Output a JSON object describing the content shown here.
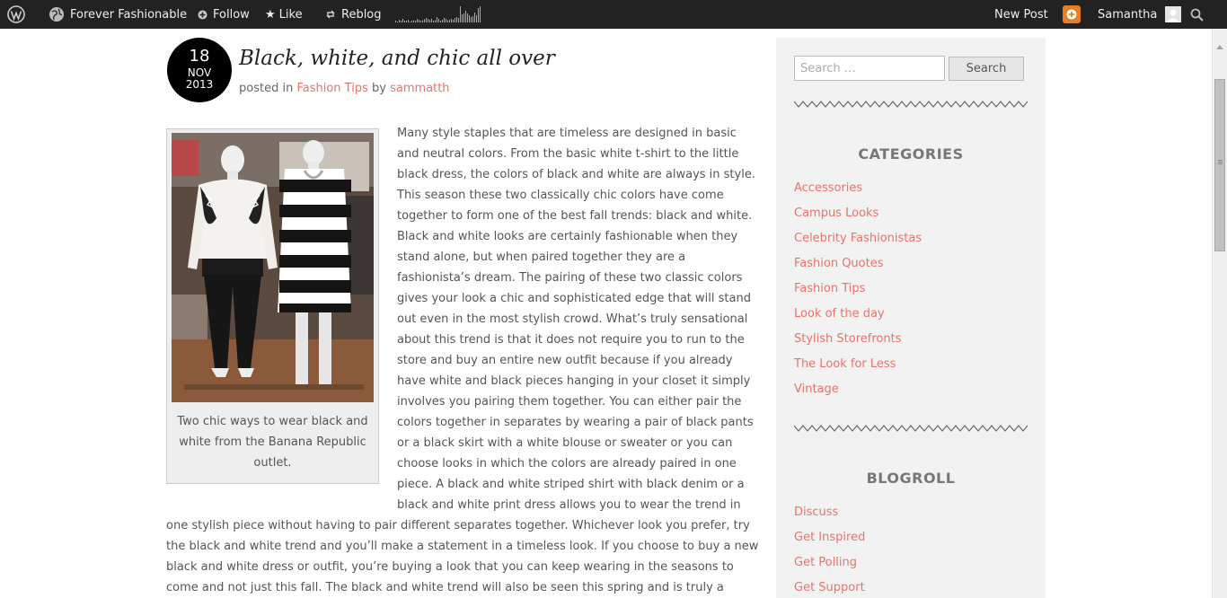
{
  "adminbar": {
    "wordpress_icon": "wordpress-logo-icon",
    "site_name": "Forever Fashionable",
    "follow_label": "Follow",
    "like_label": "Like",
    "reblog_label": "Reblog",
    "new_post_label": "New Post",
    "user_name": "Samantha",
    "stats_bars": [
      0.1,
      0.05,
      0.15,
      0.1,
      0.2,
      0.1,
      0.1,
      0.15,
      0.05,
      0.1,
      0.12,
      0.1,
      0.2,
      0.15,
      0.1,
      0.12,
      0.18,
      0.25,
      0.2,
      0.15,
      0.2,
      0.1,
      0.12,
      0.3,
      0.2,
      0.1,
      0.15,
      0.25,
      0.2,
      0.12,
      0.15,
      0.2,
      0.15,
      0.25,
      0.3,
      0.25,
      0.9,
      0.45,
      0.5,
      0.65,
      0.5,
      0.4,
      0.3,
      0.35,
      0.55,
      0.4,
      0.8,
      0.9
    ],
    "accent_color": "#e87e24"
  },
  "post": {
    "date_day": "18",
    "date_month": "NOV",
    "date_year": "2013",
    "title": "Black, white, and chic all over",
    "meta_prefix": "posted in",
    "category": "Fashion Tips",
    "meta_by": "by",
    "author": "sammatth",
    "link_color": "#e9736b",
    "caption_lines": [
      "Two chic ways to wear black and",
      "white from the Banana Republic",
      "outlet."
    ],
    "body_lines": [
      "Many style staples that are timeless are designed in basic",
      "and neutral colors. From the basic  white t-shirt to the little",
      "black dress, the colors of black and white are always in style.",
      "This  season these two classically chic colors have come",
      "together to form one of the best fall  trends: black and white.",
      "Black and white looks are certainly fashionable when they",
      "stand  alone, but when paired together they are a",
      "fashionista’s dream. The pairing of these two  classic colors",
      "gives your look a chic and sophisticated edge that will stand",
      "out even in the  most stylish crowd. What’s truly sensational",
      "about this trend is that it does not require you to  run to the",
      "store and buy an entire new outfit because if you already",
      "have white and black  pieces hanging in your closet it simply",
      "involves you pairing them together. You can either  pair the",
      "colors together in separates by wearing a pair of black pants",
      "or a black skirt with a  white blouse or sweater or you can",
      "choose looks in which the colors are already paired in one",
      " piece. A black and white striped shirt with black denim or a",
      "black and white print dress allows  you to wear the trend in"
    ],
    "body_full_lines": [
      "one stylish piece without having to pair different separates together.  Whichever look you prefer, try",
      "the black and white trend and you’ll make a statement in a  timeless look. If you choose to buy a new",
      "black and white dress or outfit, you’re buying a  look that you can keep wearing in the seasons to",
      "come and not just this fall. The black and  white trend will also be seen this spring and is truly a"
    ]
  },
  "sidebar": {
    "search_placeholder": "Search …",
    "search_button": "Search",
    "categories_title": "CATEGORIES",
    "categories": [
      "Accessories",
      "Campus Looks",
      "Celebrity Fashionistas",
      "Fashion Quotes",
      "Fashion Tips",
      "Look of the day",
      "Stylish Storefronts",
      "The Look for Less",
      "Vintage"
    ],
    "blogroll_title": "BLOGROLL",
    "blogroll": [
      "Discuss",
      "Get Inspired",
      "Get Polling",
      "Get Support"
    ]
  }
}
